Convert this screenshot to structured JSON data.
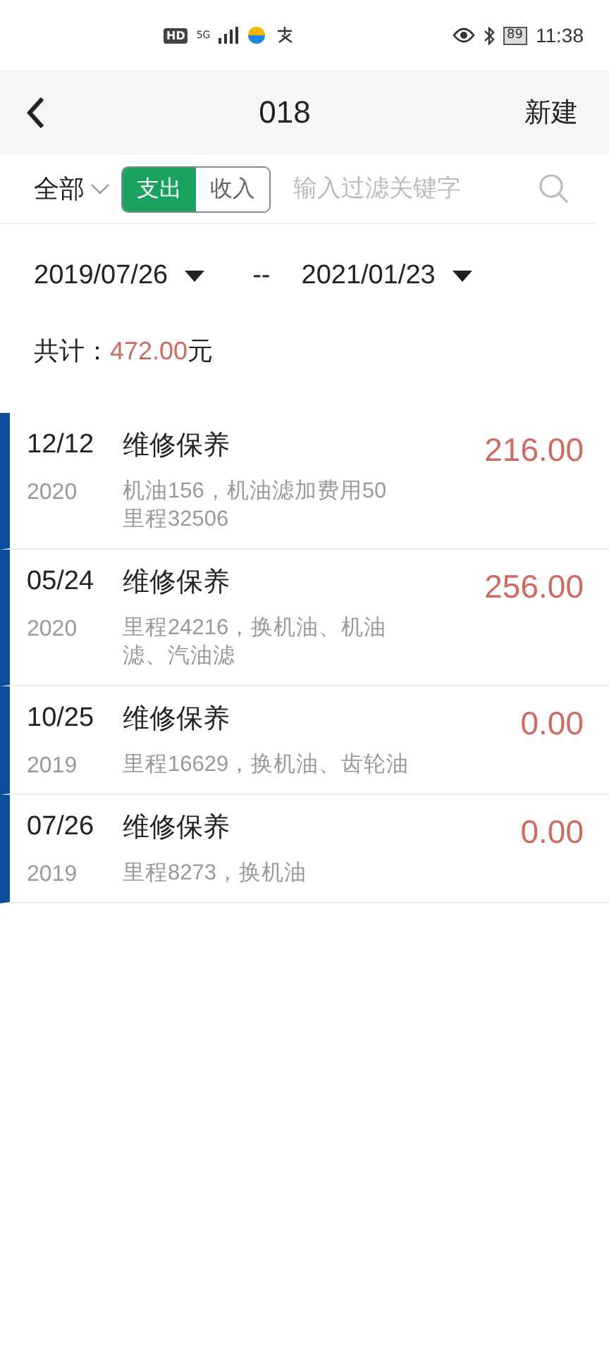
{
  "status_bar": {
    "network_badge": "HD",
    "network_type": "5G",
    "battery": "89",
    "time": "11:38"
  },
  "header": {
    "title": "018",
    "action": "新建"
  },
  "filter": {
    "category": "全部",
    "tabs": [
      {
        "label": "支出",
        "selected": true
      },
      {
        "label": "收入",
        "selected": false
      }
    ],
    "search": {
      "placeholder": "输入过滤关键字"
    }
  },
  "date_range": {
    "start": "2019/07/26",
    "separator": "--",
    "end": "2021/01/23"
  },
  "total": {
    "label": "共计：",
    "amount": "472.00",
    "unit": "元"
  },
  "records": [
    {
      "date": "12/12",
      "year": "2020",
      "category": "维修保养",
      "note": "机油156，机油滤加费用50\n里程32506",
      "amount": "216.00"
    },
    {
      "date": "05/24",
      "year": "2020",
      "category": "维修保养",
      "note": "里程24216，换机油、机油滤、汽油滤",
      "amount": "256.00"
    },
    {
      "date": "10/25",
      "year": "2019",
      "category": "维修保养",
      "note": "里程16629，换机油、齿轮油",
      "amount": "0.00"
    },
    {
      "date": "07/26",
      "year": "2019",
      "category": "维修保养",
      "note": "里程8273，换机油",
      "amount": "0.00"
    }
  ]
}
